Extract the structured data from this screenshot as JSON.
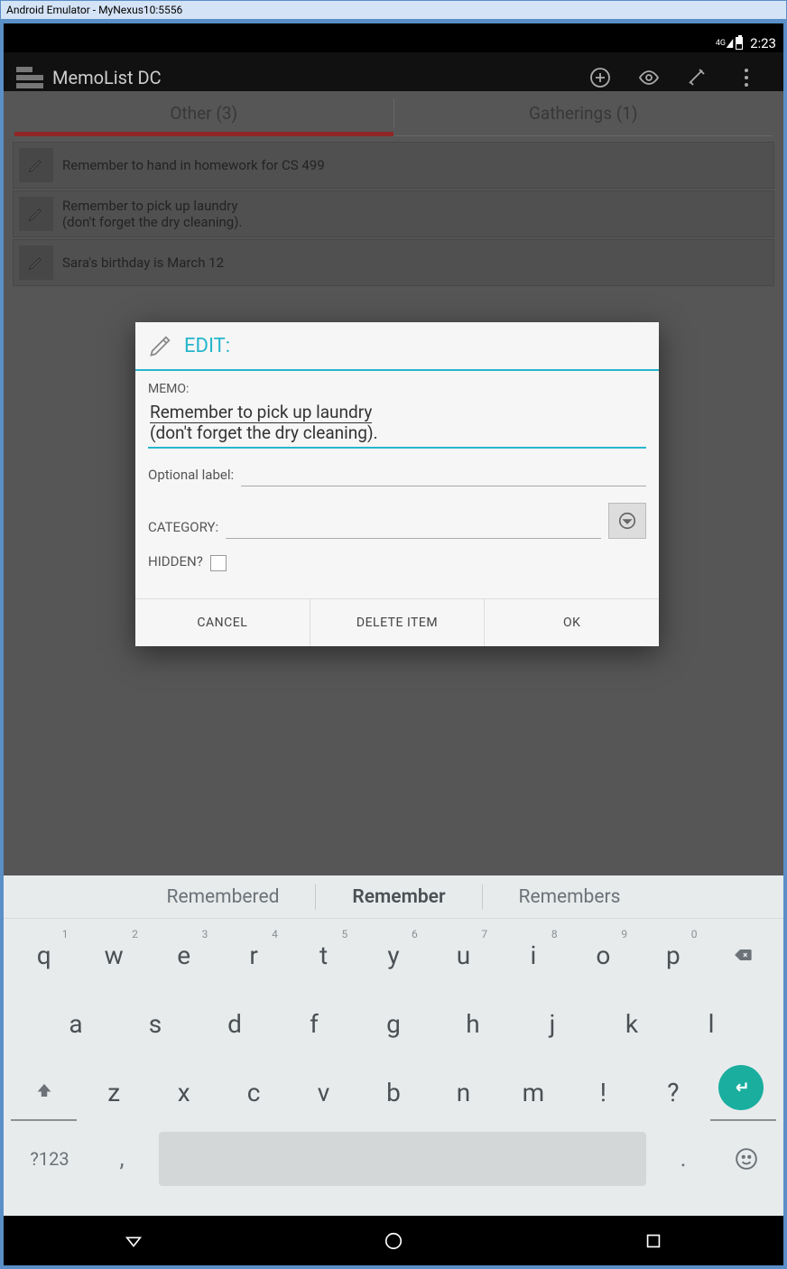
{
  "window": {
    "title": "Android Emulator - MyNexus10:5556"
  },
  "status": {
    "network": "4G",
    "time": "2:23"
  },
  "actionbar": {
    "title": "MemoList DC"
  },
  "tabs": [
    {
      "label": "Other  (3)",
      "active": true
    },
    {
      "label": "Gatherings  (1)",
      "active": false
    }
  ],
  "memos": [
    {
      "text": "Remember to hand in homework for CS 499"
    },
    {
      "text": "Remember to pick up laundry\n(don't forget the dry cleaning)."
    },
    {
      "text": "Sara's birthday is March 12"
    }
  ],
  "dialog": {
    "title": "EDIT:",
    "memo_label": "MEMO:",
    "memo_value_line1": "Remember to pick up laundry",
    "memo_value_line2": "(don't forget the dry cleaning).",
    "optional_label": "Optional label:",
    "optional_value": "",
    "category_label": "CATEGORY:",
    "category_value": "",
    "hidden_label": "HIDDEN?",
    "hidden_checked": false,
    "buttons": {
      "cancel": "CANCEL",
      "delete": "DELETE ITEM",
      "ok": "OK"
    }
  },
  "keyboard": {
    "suggestions": [
      "Remembered",
      "Remember",
      "Remembers"
    ],
    "row1": [
      {
        "k": "q",
        "h": "1"
      },
      {
        "k": "w",
        "h": "2"
      },
      {
        "k": "e",
        "h": "3"
      },
      {
        "k": "r",
        "h": "4"
      },
      {
        "k": "t",
        "h": "5"
      },
      {
        "k": "y",
        "h": "6"
      },
      {
        "k": "u",
        "h": "7"
      },
      {
        "k": "i",
        "h": "8"
      },
      {
        "k": "o",
        "h": "9"
      },
      {
        "k": "p",
        "h": "0"
      }
    ],
    "row2": [
      "a",
      "s",
      "d",
      "f",
      "g",
      "h",
      "j",
      "k",
      "l"
    ],
    "row3": [
      "z",
      "x",
      "c",
      "v",
      "b",
      "n",
      "m",
      "!",
      "?"
    ],
    "sym": "?123",
    "comma": ",",
    "dot": "."
  }
}
